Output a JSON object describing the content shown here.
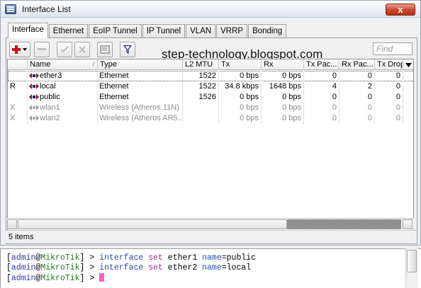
{
  "window": {
    "title": "Interface List",
    "close_label": "x"
  },
  "tabs": [
    {
      "label": "Interface"
    },
    {
      "label": "Ethernet"
    },
    {
      "label": "EoIP Tunnel"
    },
    {
      "label": "IP Tunnel"
    },
    {
      "label": "VLAN"
    },
    {
      "label": "VRRP"
    },
    {
      "label": "Bonding"
    }
  ],
  "toolbar": {
    "find_placeholder": "Find"
  },
  "watermark": "step-technology.blogspot.com",
  "table": {
    "columns": [
      "Name",
      "Type",
      "L2 MTU",
      "Tx",
      "Rx",
      "Tx Pac...",
      "Rx Pac...",
      "Tx Drop"
    ],
    "rows": [
      {
        "flag": "",
        "name": "ether3",
        "type": "Ethernet",
        "mtu": "1522",
        "tx": "0 bps",
        "rx": "0 bps",
        "txp": "0",
        "rxp": "0",
        "txd": "0"
      },
      {
        "flag": "R",
        "name": "local",
        "type": "Ethernet",
        "mtu": "1522",
        "tx": "34.8 kbps",
        "rx": "1648 bps",
        "txp": "4",
        "rxp": "2",
        "txd": "0"
      },
      {
        "flag": "",
        "name": "public",
        "type": "Ethernet",
        "mtu": "1526",
        "tx": "0 bps",
        "rx": "0 bps",
        "txp": "0",
        "rxp": "0",
        "txd": "0"
      },
      {
        "flag": "X",
        "name": "wlan1",
        "type": "Wireless (Atheros 11N)",
        "mtu": "",
        "tx": "0 bps",
        "rx": "0 bps",
        "txp": "0",
        "rxp": "0",
        "txd": "0"
      },
      {
        "flag": "X",
        "name": "wlan2",
        "type": "Wireless (Atheros AR5...",
        "mtu": "",
        "tx": "0 bps",
        "rx": "0 bps",
        "txp": "0",
        "rxp": "0",
        "txd": "0"
      }
    ]
  },
  "status": {
    "items_count": "5 items"
  },
  "terminal": {
    "lines": [
      {
        "user": "admin",
        "host": "MikroTik",
        "cmd1": "interface",
        "cmd2": "set",
        "arg": "ether1",
        "key": "name",
        "val": "public"
      },
      {
        "user": "admin",
        "host": "MikroTik",
        "cmd1": "interface",
        "cmd2": "set",
        "arg": "ether2",
        "key": "name",
        "val": "local"
      },
      {
        "user": "admin",
        "host": "MikroTik"
      }
    ]
  },
  "colors": {
    "close": "#c9452b",
    "cursor": "#ff5ec2",
    "terminal_user": "#3535b5",
    "terminal_host": "#1f7a1f"
  }
}
